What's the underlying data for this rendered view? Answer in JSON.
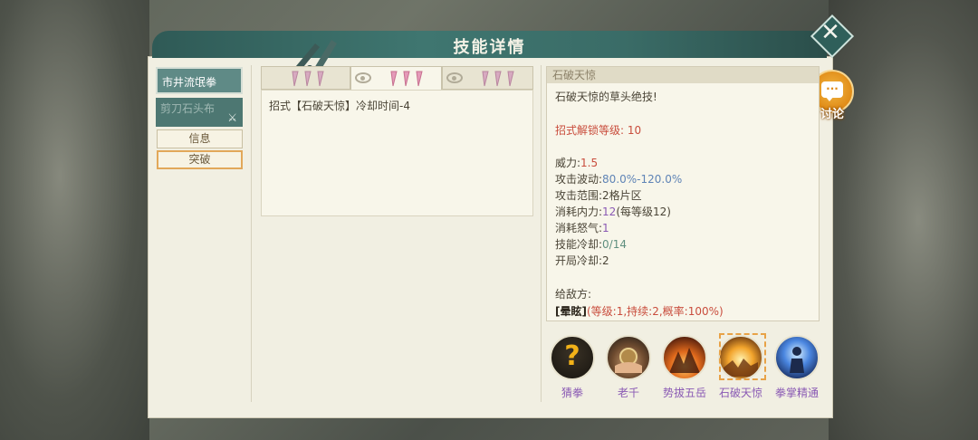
{
  "header": {
    "title": "技能详情"
  },
  "discuss_button": {
    "label": "讨论"
  },
  "left_tabs": [
    {
      "label": "市井流氓拳"
    },
    {
      "label": "剪刀石头布"
    }
  ],
  "left_buttons": {
    "info": "信息",
    "breakthrough": "突破"
  },
  "middle": {
    "text": "招式【石破天惊】冷却时间-4"
  },
  "detail": {
    "title": "石破天惊",
    "desc": "石破天惊的草头绝技!",
    "unlock_label": "招式解锁等级:",
    "unlock_value": "10",
    "power_label": "威力:",
    "power_value": "1.5",
    "wave_label": "攻击波动:",
    "wave_value": "80.0%-120.0%",
    "range_label": "攻击范围:",
    "range_value": "2格片区",
    "inner_label": "消耗内力:",
    "inner_value": "12",
    "inner_extra": "(每等级12)",
    "rage_label": "消耗怒气:",
    "rage_value": "1",
    "cd_label": "技能冷却:",
    "cd_value": "0/14",
    "open_cd_label": "开局冷却:",
    "open_cd_value": "2",
    "enemy_label": "给敌方:",
    "effect_name": "[晕眩]",
    "effect_detail": "(等级:1,持续:2,概率:100%)"
  },
  "skills": [
    {
      "name": "猜拳"
    },
    {
      "name": "老千"
    },
    {
      "name": "势拔五岳"
    },
    {
      "name": "石破天惊"
    },
    {
      "name": "拳掌精通"
    }
  ],
  "colors": {
    "header": "#3f7670",
    "accent_orange": "#e8a247",
    "skill_name": "#8a5ab4"
  }
}
